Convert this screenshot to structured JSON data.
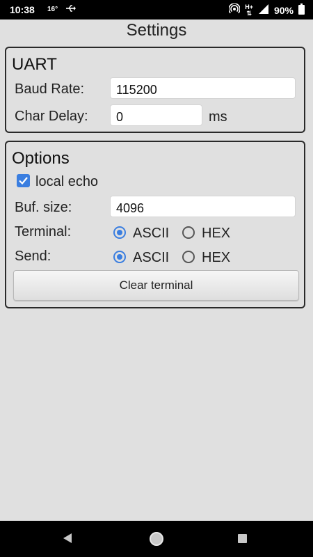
{
  "status_bar": {
    "time": "10:38",
    "temperature": "16°",
    "usb_icon": "usb-icon",
    "network_type": "H+",
    "battery": "90%"
  },
  "page": {
    "title": "Settings"
  },
  "uart": {
    "title": "UART",
    "baud_rate_label": "Baud Rate:",
    "baud_rate_value": "115200",
    "char_delay_label": "Char Delay:",
    "char_delay_value": "0",
    "char_delay_unit": "ms"
  },
  "options": {
    "title": "Options",
    "local_echo_label": "local echo",
    "local_echo_checked": true,
    "buf_size_label": "Buf. size:",
    "buf_size_value": "4096",
    "terminal_label": "Terminal:",
    "terminal_options": [
      "ASCII",
      "HEX"
    ],
    "terminal_selected": "ASCII",
    "send_label": "Send:",
    "send_options": [
      "ASCII",
      "HEX"
    ],
    "send_selected": "ASCII",
    "clear_button_label": "Clear terminal"
  },
  "colors": {
    "accent": "#3a7ee0",
    "background": "#e0e0e0",
    "bar": "#000000"
  }
}
